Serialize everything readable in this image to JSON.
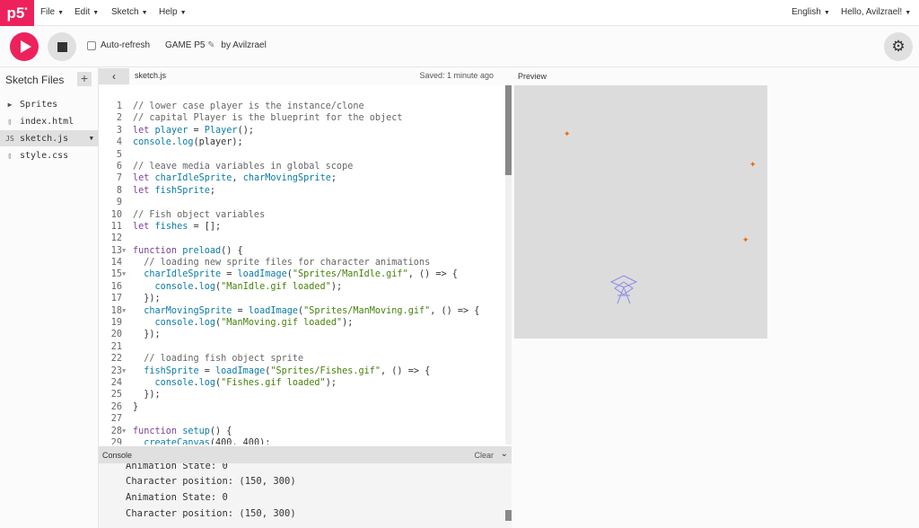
{
  "menu": {
    "logo": "p5",
    "logo_sup": "*",
    "file": "File",
    "edit": "Edit",
    "sketch": "Sketch",
    "help": "Help",
    "language": "English",
    "greeting": "Hello, Avilzrael!"
  },
  "toolbar": {
    "autorefresh": "Auto-refresh",
    "sketch_name": "GAME P5",
    "edit_icon": "✎",
    "by_label": "by Avilzrael"
  },
  "sidebar": {
    "title": "Sketch Files",
    "add_label": "+",
    "files": [
      {
        "name": "Sprites",
        "icon": "▶"
      },
      {
        "name": "index.html",
        "icon": "▯"
      },
      {
        "name": "sketch.js",
        "icon": "JS"
      },
      {
        "name": "style.css",
        "icon": "▯"
      }
    ]
  },
  "editor": {
    "back_label": "‹",
    "tab": "sketch.js",
    "saved": "Saved: 1 minute ago",
    "lines": [
      {
        "n": "1",
        "f": "",
        "t": [
          [
            "cm",
            "// lower case player is the instance/clone"
          ]
        ]
      },
      {
        "n": "2",
        "f": "",
        "t": [
          [
            "cm",
            "// capital Player is the blueprint for the object"
          ]
        ]
      },
      {
        "n": "3",
        "f": "",
        "t": [
          [
            "kw",
            "let "
          ],
          [
            "fn",
            "player"
          ],
          [
            "pl",
            " = "
          ],
          [
            "fn",
            "Player"
          ],
          [
            "pl",
            "();"
          ]
        ]
      },
      {
        "n": "4",
        "f": "",
        "t": [
          [
            "fn",
            "console"
          ],
          [
            "pl",
            "."
          ],
          [
            "fn",
            "log"
          ],
          [
            "pl",
            "(player);"
          ]
        ]
      },
      {
        "n": "5",
        "f": "",
        "t": []
      },
      {
        "n": "6",
        "f": "",
        "t": [
          [
            "cm",
            "// leave media variables in global scope"
          ]
        ]
      },
      {
        "n": "7",
        "f": "",
        "t": [
          [
            "kw",
            "let "
          ],
          [
            "fn",
            "charIdleSprite"
          ],
          [
            "pl",
            ", "
          ],
          [
            "fn",
            "charMovingSprite"
          ],
          [
            "pl",
            ";"
          ]
        ]
      },
      {
        "n": "8",
        "f": "",
        "t": [
          [
            "kw",
            "let "
          ],
          [
            "fn",
            "fishSprite"
          ],
          [
            "pl",
            ";"
          ]
        ]
      },
      {
        "n": "9",
        "f": "",
        "t": []
      },
      {
        "n": "10",
        "f": "",
        "t": [
          [
            "cm",
            "// Fish object variables"
          ]
        ]
      },
      {
        "n": "11",
        "f": "",
        "t": [
          [
            "kw",
            "let "
          ],
          [
            "fn",
            "fishes"
          ],
          [
            "pl",
            " = [];"
          ]
        ]
      },
      {
        "n": "12",
        "f": "",
        "t": []
      },
      {
        "n": "13",
        "f": "▼",
        "t": [
          [
            "kw",
            "function "
          ],
          [
            "fn",
            "preload"
          ],
          [
            "pl",
            "() {"
          ]
        ]
      },
      {
        "n": "14",
        "f": "",
        "t": [
          [
            "cm",
            "  // loading new sprite files for character animations"
          ]
        ]
      },
      {
        "n": "15",
        "f": "▼",
        "t": [
          [
            "fn",
            "  charIdleSprite"
          ],
          [
            "pl",
            " = "
          ],
          [
            "fn",
            "loadImage"
          ],
          [
            "pl",
            "("
          ],
          [
            "st",
            "\"Sprites/ManIdle.gif\""
          ],
          [
            "pl",
            ", () => {"
          ]
        ]
      },
      {
        "n": "16",
        "f": "",
        "t": [
          [
            "fn",
            "    console"
          ],
          [
            "pl",
            "."
          ],
          [
            "fn",
            "log"
          ],
          [
            "pl",
            "("
          ],
          [
            "st",
            "\"ManIdle.gif loaded\""
          ],
          [
            "pl",
            ");"
          ]
        ]
      },
      {
        "n": "17",
        "f": "",
        "t": [
          [
            "pl",
            "  });"
          ]
        ]
      },
      {
        "n": "18",
        "f": "▼",
        "t": [
          [
            "fn",
            "  charMovingSprite"
          ],
          [
            "pl",
            " = "
          ],
          [
            "fn",
            "loadImage"
          ],
          [
            "pl",
            "("
          ],
          [
            "st",
            "\"Sprites/ManMoving.gif\""
          ],
          [
            "pl",
            ", () => {"
          ]
        ]
      },
      {
        "n": "19",
        "f": "",
        "t": [
          [
            "fn",
            "    console"
          ],
          [
            "pl",
            "."
          ],
          [
            "fn",
            "log"
          ],
          [
            "pl",
            "("
          ],
          [
            "st",
            "\"ManMoving.gif loaded\""
          ],
          [
            "pl",
            ");"
          ]
        ]
      },
      {
        "n": "20",
        "f": "",
        "t": [
          [
            "pl",
            "  });"
          ]
        ]
      },
      {
        "n": "21",
        "f": "",
        "t": []
      },
      {
        "n": "22",
        "f": "",
        "t": [
          [
            "cm",
            "  // loading fish object sprite"
          ]
        ]
      },
      {
        "n": "23",
        "f": "▼",
        "t": [
          [
            "fn",
            "  fishSprite"
          ],
          [
            "pl",
            " = "
          ],
          [
            "fn",
            "loadImage"
          ],
          [
            "pl",
            "("
          ],
          [
            "st",
            "\"Sprites/Fishes.gif\""
          ],
          [
            "pl",
            ", () => {"
          ]
        ]
      },
      {
        "n": "24",
        "f": "",
        "t": [
          [
            "fn",
            "    console"
          ],
          [
            "pl",
            "."
          ],
          [
            "fn",
            "log"
          ],
          [
            "pl",
            "("
          ],
          [
            "st",
            "\"Fishes.gif loaded\""
          ],
          [
            "pl",
            ");"
          ]
        ]
      },
      {
        "n": "25",
        "f": "",
        "t": [
          [
            "pl",
            "  });"
          ]
        ]
      },
      {
        "n": "26",
        "f": "",
        "t": [
          [
            "pl",
            "}"
          ]
        ]
      },
      {
        "n": "27",
        "f": "",
        "t": []
      },
      {
        "n": "28",
        "f": "▼",
        "t": [
          [
            "kw",
            "function "
          ],
          [
            "fn",
            "setup"
          ],
          [
            "pl",
            "() {"
          ]
        ]
      },
      {
        "n": "29",
        "f": "",
        "t": [
          [
            "fn",
            "  createCanvas"
          ],
          [
            "pl",
            "(400, 400);"
          ]
        ]
      }
    ]
  },
  "console": {
    "title": "Console",
    "clear": "Clear",
    "lines": [
      "Animation State: 0",
      "Character position: (150, 300)",
      "Animation State: 0",
      "Character position: (150, 300)"
    ]
  },
  "preview": {
    "label": "Preview",
    "fish_glyph": "✦"
  },
  "colors": {
    "accent": "#ed225d",
    "comment": "#666666",
    "keyword": "#7a3e9d",
    "identifier": "#0b7ca9",
    "string": "#47820a"
  }
}
